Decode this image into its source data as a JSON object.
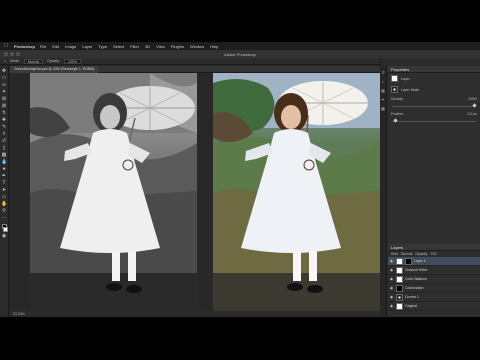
{
  "menubar": {
    "app_name": "Photoshop",
    "items": [
      "File",
      "Edit",
      "Image",
      "Layer",
      "Type",
      "Select",
      "Filter",
      "3D",
      "View",
      "Plugins",
      "Window",
      "Help"
    ]
  },
  "titlebar": {
    "title": "Adobe Photoshop"
  },
  "options_bar": {
    "mode_label": "Mode:",
    "mode_value": "Normal",
    "opacity_label": "Opacity:",
    "opacity_value": "100%"
  },
  "document": {
    "tab_title": "GreenHolidayHat.psd @ 33% (Rectangle 1, RGB/8)",
    "status": "33.33%"
  },
  "panels": {
    "properties_title": "Properties",
    "properties_rows": [
      "Layer",
      "Layer Mask"
    ],
    "properties_fields": [
      {
        "label": "Density:",
        "value": "100%"
      },
      {
        "label": "Feather:",
        "value": "0.0 px"
      }
    ],
    "layers_title": "Layers",
    "layers_tools": [
      "Kind",
      "Normal",
      "Opacity:",
      "Fill:"
    ],
    "layers": [
      {
        "name": "Layer 1",
        "thumb": "white",
        "active": true
      },
      {
        "name": "Channel Mixer",
        "thumb": "white",
        "active": false
      },
      {
        "name": "Color Balance",
        "thumb": "white",
        "active": false
      },
      {
        "name": "Colorization",
        "thumb": "black",
        "active": false
      },
      {
        "name": "Curves 1",
        "thumb": "mask",
        "active": false
      },
      {
        "name": "Original",
        "thumb": "white",
        "active": false
      }
    ]
  },
  "colors": {
    "app_bg": "#262626",
    "menubar_bg": "#1d1d1d",
    "panel_bg": "#2e2e2e",
    "active_layer": "#3f4d5c"
  }
}
